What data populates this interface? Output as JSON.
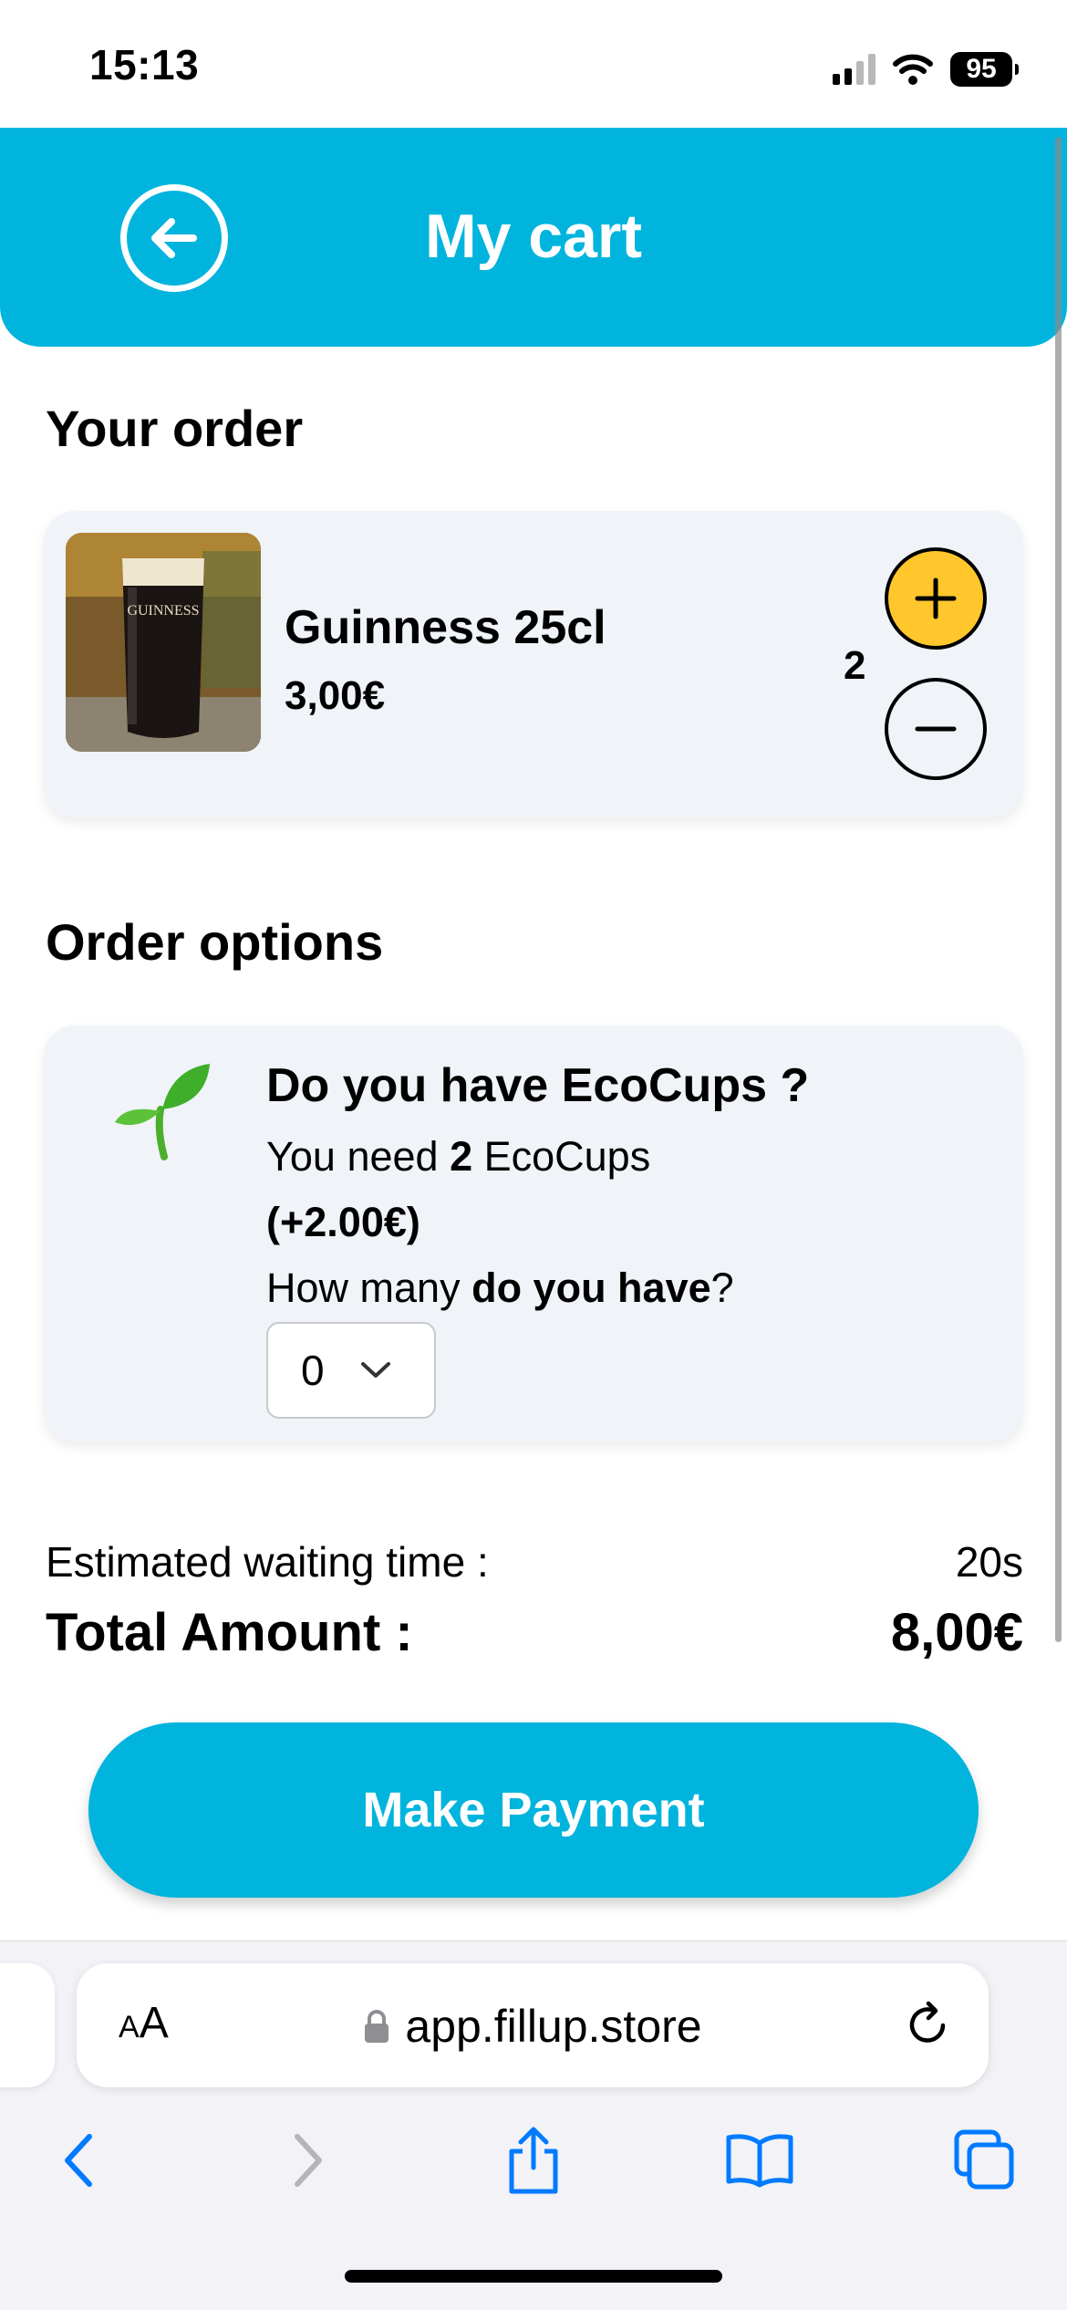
{
  "status_bar": {
    "time": "15:13",
    "battery": "95"
  },
  "header": {
    "title": "My cart"
  },
  "order": {
    "section_title": "Your order",
    "item": {
      "name": "Guinness 25cl",
      "price": "3,00€",
      "quantity": "2",
      "image_text": "GUINNESS"
    }
  },
  "options": {
    "section_title": "Order options",
    "title": "Do you have EcoCups ?",
    "need_prefix": "You need ",
    "need_count": "2",
    "need_suffix": " EcoCups",
    "extra_cost": "(+2.00€)",
    "question_prefix": "How many ",
    "question_bold": "do you have",
    "question_suffix": "?",
    "selected": "0"
  },
  "summary": {
    "waiting_label": "Estimated waiting time :",
    "waiting_value": "20s",
    "total_label": "Total Amount :",
    "total_value": "8,00€"
  },
  "pay_button": "Make Payment",
  "browser": {
    "text_size_label_small": "A",
    "text_size_label_large": "A",
    "url": "app.fillup.store"
  },
  "colors": {
    "accent": "#00b4dd",
    "plus_button": "#ffc72c",
    "card": "#f0f3f8",
    "browser_blue": "#007aff"
  }
}
